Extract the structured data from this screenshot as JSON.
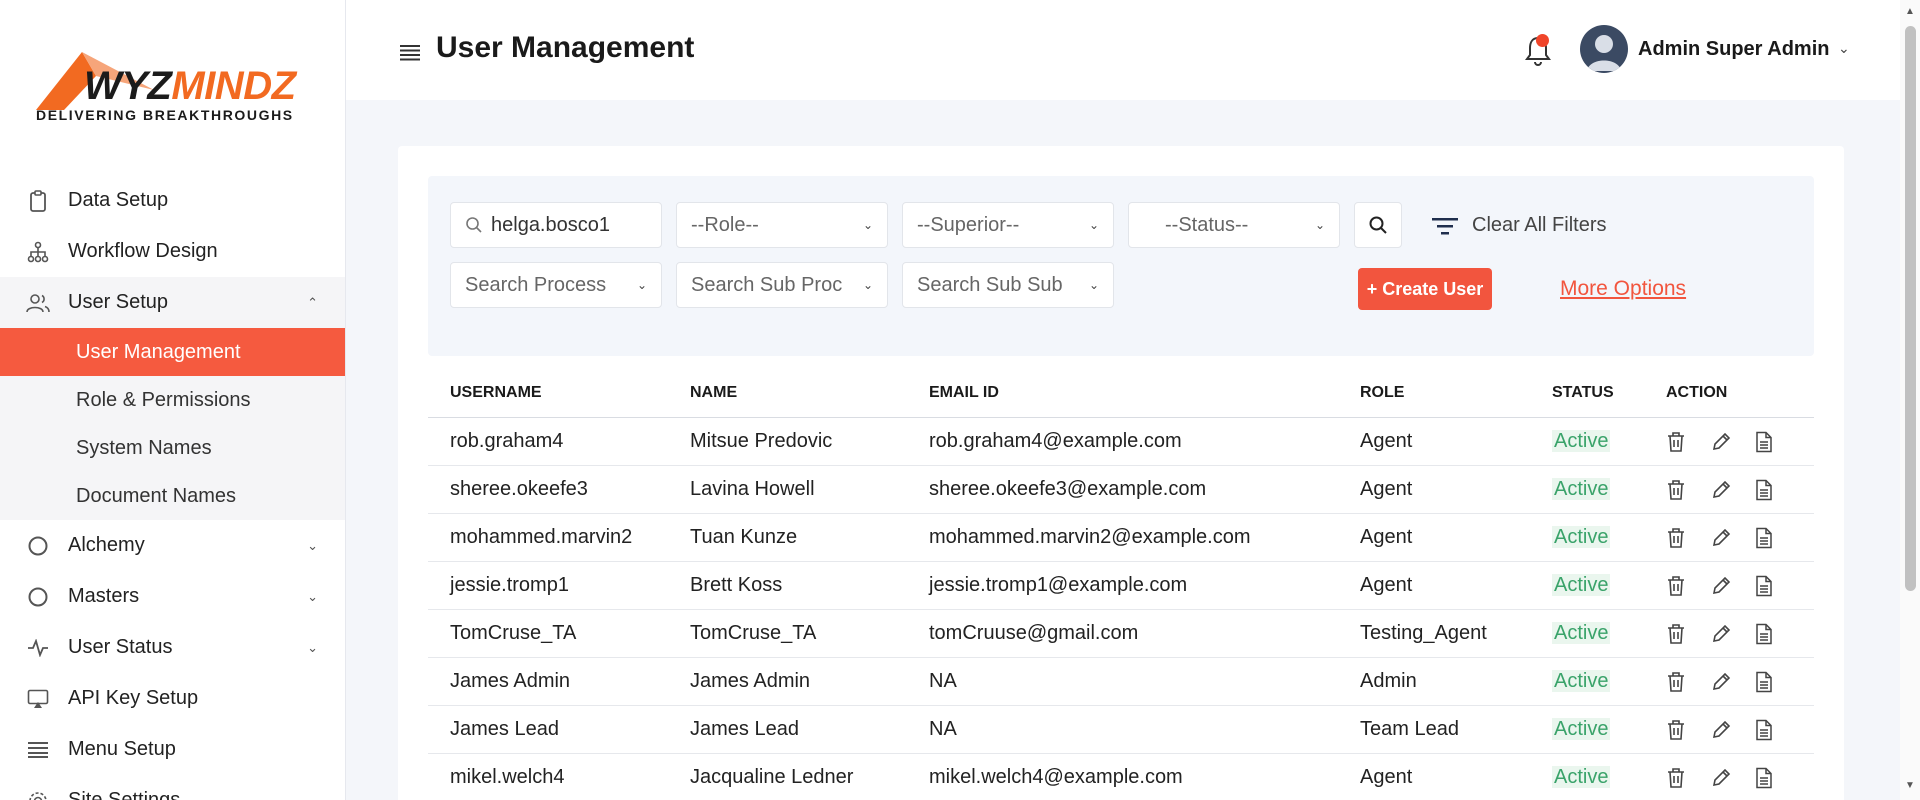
{
  "brand": {
    "name_part1": "WYZ",
    "name_part2": "MINDZ",
    "tagline": "DELIVERING BREAKTHROUGHS",
    "accent": "#f26a21"
  },
  "sidebar": {
    "items": [
      {
        "label": "Data Setup",
        "icon": "clipboard-icon"
      },
      {
        "label": "Workflow Design",
        "icon": "hierarchy-icon"
      },
      {
        "label": "User Setup",
        "icon": "users-icon",
        "expanded": true
      },
      {
        "label": "Alchemy",
        "icon": "circle-icon"
      },
      {
        "label": "Masters",
        "icon": "circle-icon"
      },
      {
        "label": "User Status",
        "icon": "activity-icon"
      },
      {
        "label": "API Key Setup",
        "icon": "monitor-icon"
      },
      {
        "label": "Menu Setup",
        "icon": "list-icon"
      },
      {
        "label": "Site Settings",
        "icon": "gear-icon"
      }
    ],
    "user_setup_sub": [
      {
        "label": "User Management",
        "active": true
      },
      {
        "label": "Role & Permissions"
      },
      {
        "label": "System Names"
      },
      {
        "label": "Document Names"
      }
    ]
  },
  "header": {
    "title": "User Management",
    "admin_name": "Admin Super Admin",
    "notification_dot_color": "#f0452a"
  },
  "filters": {
    "search_value": "helga.bosco1",
    "role_placeholder": "--Role--",
    "superior_placeholder": "--Superior--",
    "status_placeholder": "--Status--",
    "process_placeholder": "Search Process",
    "sub_process_placeholder": "Search Sub Proc",
    "sub_sub_placeholder": "Search Sub Sub",
    "clear_label": "Clear All Filters",
    "create_label": "+ Create User",
    "more_label": "More Options"
  },
  "table": {
    "headers": [
      "USERNAME",
      "NAME",
      "EMAIL ID",
      "ROLE",
      "STATUS",
      "ACTION"
    ],
    "rows": [
      [
        "rob.graham4",
        "Mitsue Predovic",
        "rob.graham4@example.com",
        "Agent",
        "Active"
      ],
      [
        "sheree.okeefe3",
        "Lavina Howell",
        "sheree.okeefe3@example.com",
        "Agent",
        "Active"
      ],
      [
        "mohammed.marvin2",
        "Tuan Kunze",
        "mohammed.marvin2@example.com",
        "Agent",
        "Active"
      ],
      [
        "jessie.tromp1",
        "Brett Koss",
        "jessie.tromp1@example.com",
        "Agent",
        "Active"
      ],
      [
        "TomCruse_TA",
        "TomCruse_TA",
        "tomCruuse@gmail.com",
        "Testing_Agent",
        "Active"
      ],
      [
        "James Admin",
        "James Admin",
        "NA",
        "Admin",
        "Active"
      ],
      [
        "James Lead",
        "James Lead",
        "NA",
        "Team Lead",
        "Active"
      ],
      [
        "mikel.welch4",
        "Jacqualine Ledner",
        "mikel.welch4@example.com",
        "Agent",
        "Active"
      ]
    ]
  },
  "colors": {
    "primary": "#f2553e",
    "status_active": "#3aa36a"
  }
}
